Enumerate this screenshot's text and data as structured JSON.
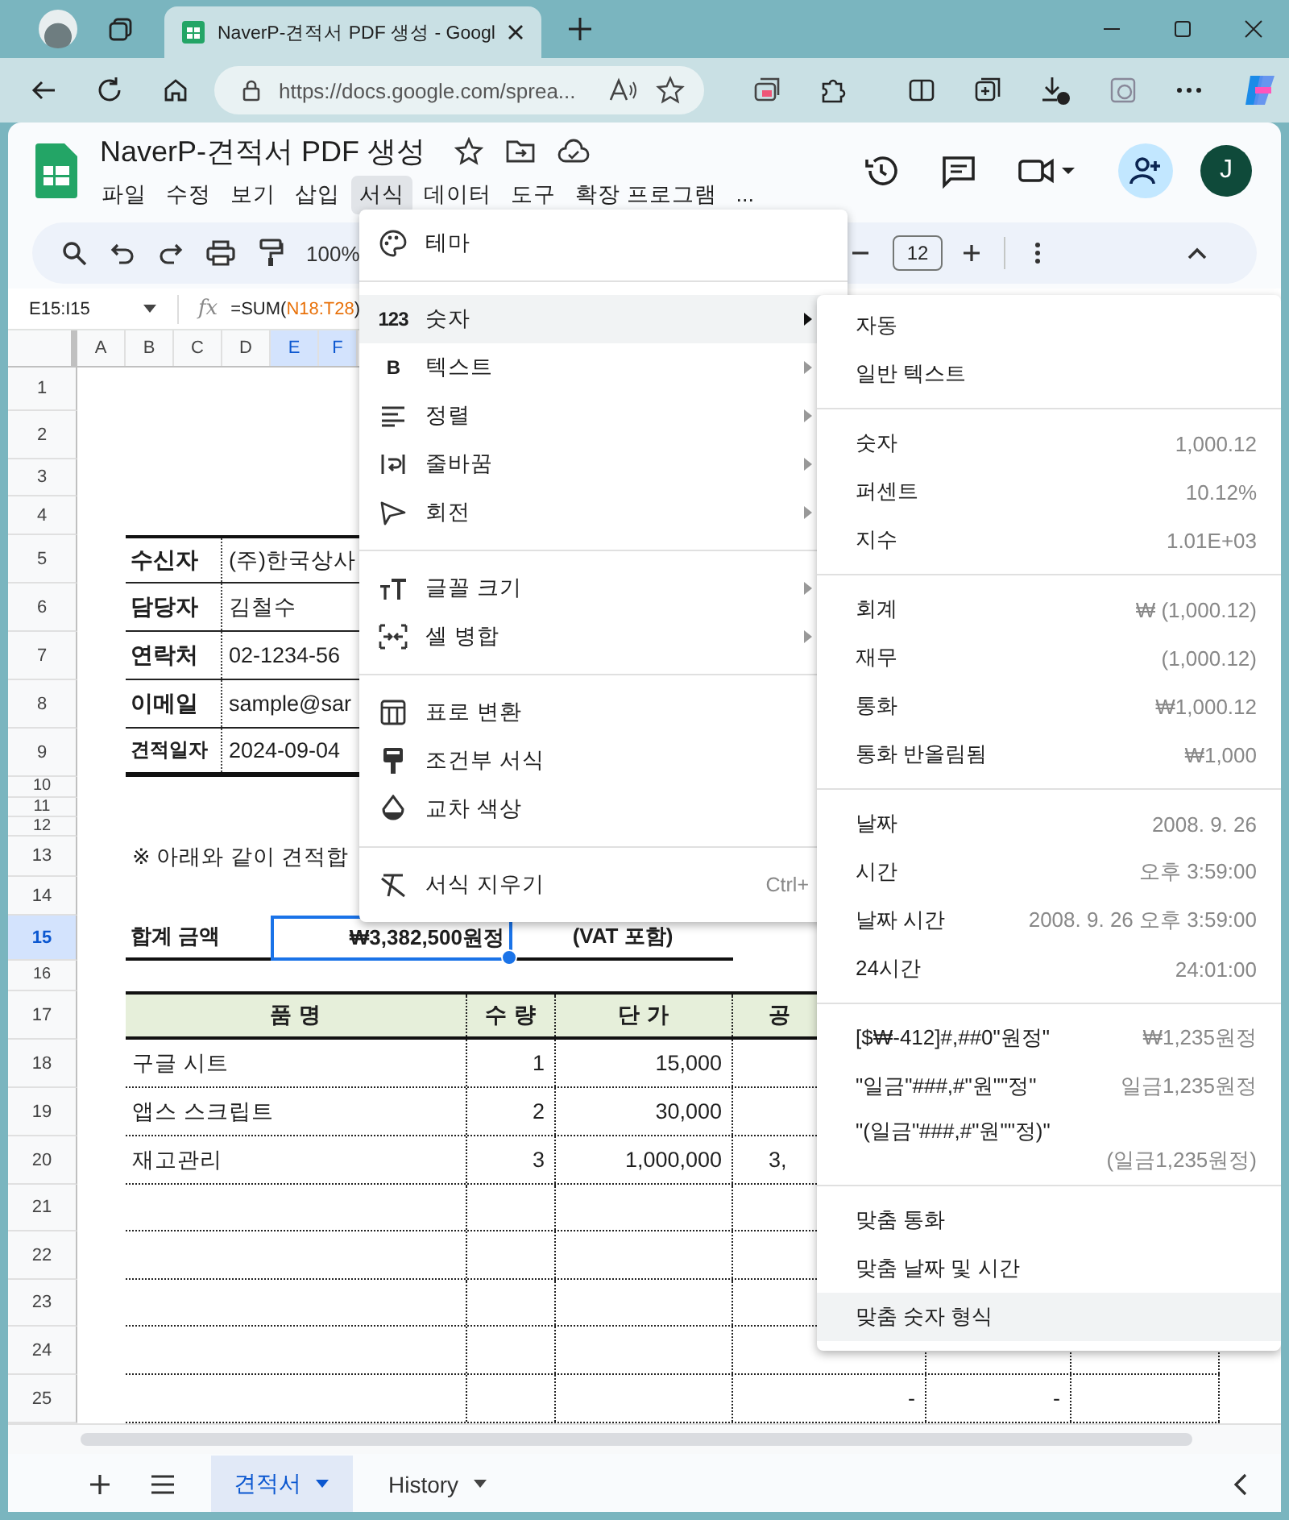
{
  "browser": {
    "tab_title": "NaverP-견적서 PDF 생성 - Googl",
    "url": "https://docs.google.com/sprea..."
  },
  "document": {
    "title": "NaverP-견적서 PDF 생성",
    "avatar_initial": "J"
  },
  "menu_bar": [
    {
      "label": "파일",
      "selected": false
    },
    {
      "label": "수정",
      "selected": false
    },
    {
      "label": "보기",
      "selected": false
    },
    {
      "label": "삽입",
      "selected": false
    },
    {
      "label": "서식",
      "selected": true
    },
    {
      "label": "데이터",
      "selected": false
    },
    {
      "label": "도구",
      "selected": false
    },
    {
      "label": "확장 프로그램",
      "selected": false
    },
    {
      "label": "...",
      "selected": false
    }
  ],
  "toolbar": {
    "zoom": "100%",
    "font_size": "12"
  },
  "formula_bar": {
    "range": "E15:I15",
    "fx": "fx",
    "formula_start": "=SUM(",
    "formula_ref": "N18:T28",
    "formula_end": ")"
  },
  "columns": [
    {
      "label": "A",
      "selected": false
    },
    {
      "label": "B",
      "selected": false
    },
    {
      "label": "C",
      "selected": false
    },
    {
      "label": "D",
      "selected": false
    },
    {
      "label": "E",
      "selected": true
    },
    {
      "label": "F",
      "selected": true
    }
  ],
  "rows": [
    {
      "number": "1",
      "kind": "blank",
      "selected": false
    },
    {
      "number": "2",
      "kind": "blank",
      "selected": false
    },
    {
      "number": "3",
      "kind": "blank",
      "selected": false
    },
    {
      "number": "4",
      "kind": "blank",
      "selected": false
    },
    {
      "number": "5",
      "kind": "info",
      "selected": false,
      "label": "수신자",
      "value": "(주)한국상사"
    },
    {
      "number": "6",
      "kind": "info",
      "selected": false,
      "label": "담당자",
      "value": "김철수"
    },
    {
      "number": "7",
      "kind": "info",
      "selected": false,
      "label": "연락처",
      "value": "02-1234-56"
    },
    {
      "number": "8",
      "kind": "info",
      "selected": false,
      "label": "이메일",
      "value": "sample@sar"
    },
    {
      "number": "9",
      "kind": "info",
      "selected": false,
      "label": "견적일자",
      "value": "2024-09-04"
    },
    {
      "number": "10",
      "kind": "blank",
      "selected": false
    },
    {
      "number": "11",
      "kind": "blank",
      "selected": false
    },
    {
      "number": "12",
      "kind": "blank",
      "selected": false
    },
    {
      "number": "13",
      "kind": "note",
      "selected": false,
      "text": "※ 아래와 같이 견적합"
    },
    {
      "number": "14",
      "kind": "blank",
      "selected": false
    },
    {
      "number": "15",
      "kind": "total",
      "selected": true,
      "label": "합계 금액",
      "value": "₩3,382,500원정",
      "note": "(VAT 포함)"
    },
    {
      "number": "16",
      "kind": "blank",
      "selected": false
    },
    {
      "number": "17",
      "kind": "table_header",
      "selected": false,
      "cells": [
        "품 명",
        "수 량",
        "단 가",
        "공"
      ]
    },
    {
      "number": "18",
      "kind": "table_row",
      "selected": false,
      "cells": [
        "구글 시트",
        "1",
        "15,000"
      ]
    },
    {
      "number": "19",
      "kind": "table_row",
      "selected": false,
      "cells": [
        "앱스 스크립트",
        "2",
        "30,000"
      ]
    },
    {
      "number": "20",
      "kind": "table_row",
      "selected": false,
      "cells": [
        "재고관리",
        "3",
        "1,000,000",
        "3,"
      ]
    },
    {
      "number": "21",
      "kind": "table_row",
      "selected": false
    },
    {
      "number": "22",
      "kind": "table_row",
      "selected": false
    },
    {
      "number": "23",
      "kind": "table_row",
      "selected": false
    },
    {
      "number": "24",
      "kind": "table_row",
      "selected": false
    },
    {
      "number": "25",
      "kind": "table_tail",
      "selected": false,
      "values": [
        "-",
        "-"
      ]
    }
  ],
  "format_menu": [
    [
      {
        "label": "테마",
        "submenu": false,
        "selected": false
      }
    ],
    [
      {
        "glyph": "123",
        "label": "숫자",
        "submenu": true,
        "selected": true
      },
      {
        "glyph": "B",
        "label": "텍스트",
        "submenu": true,
        "selected": false
      },
      {
        "label": "정렬",
        "submenu": true,
        "selected": false
      },
      {
        "label": "줄바꿈",
        "submenu": true,
        "selected": false
      },
      {
        "label": "회전",
        "submenu": true,
        "selected": false
      }
    ],
    [
      {
        "label": "글꼴 크기",
        "submenu": true,
        "selected": false
      },
      {
        "label": "셀 병합",
        "submenu": true,
        "selected": false
      }
    ],
    [
      {
        "label": "표로 변환",
        "submenu": false,
        "selected": false
      },
      {
        "label": "조건부 서식",
        "submenu": false,
        "selected": false
      },
      {
        "label": "교차 색상",
        "submenu": false,
        "selected": false
      }
    ],
    [
      {
        "label": "서식 지우기",
        "shortcut": "Ctrl+",
        "submenu": false,
        "selected": false
      }
    ]
  ],
  "number_menu": [
    [
      {
        "label": "자동",
        "kind": "inline",
        "selected": false
      },
      {
        "label": "일반 텍스트",
        "kind": "inline",
        "selected": false
      }
    ],
    [
      {
        "label": "숫자",
        "example": "1,000.12",
        "kind": "inline",
        "selected": false
      },
      {
        "label": "퍼센트",
        "example": "10.12%",
        "kind": "inline",
        "selected": false
      },
      {
        "label": "지수",
        "example": "1.01E+03",
        "kind": "inline",
        "selected": false
      }
    ],
    [
      {
        "label": "회계",
        "example": "₩ (1,000.12)",
        "kind": "inline",
        "selected": false
      },
      {
        "label": "재무",
        "example": "(1,000.12)",
        "kind": "inline",
        "selected": false
      },
      {
        "label": "통화",
        "example": "₩1,000.12",
        "kind": "inline",
        "selected": false
      },
      {
        "label": "통화 반올림됨",
        "example": "₩1,000",
        "kind": "inline",
        "selected": false
      }
    ],
    [
      {
        "label": "날짜",
        "example": "2008. 9. 26",
        "kind": "inline",
        "selected": false
      },
      {
        "label": "시간",
        "example": "오후 3:59:00",
        "kind": "inline",
        "selected": false
      },
      {
        "label": "날짜 시간",
        "example": "2008. 9. 26 오후 3:59:00",
        "kind": "inline",
        "selected": false
      },
      {
        "label": "24시간",
        "example": "24:01:00",
        "kind": "inline",
        "selected": false
      }
    ],
    [
      {
        "label": "[$₩-412]#,##0\"원정\"",
        "example": "₩1,235원정",
        "kind": "inline",
        "selected": false
      },
      {
        "label": "\"일금\"###,#\"원\"\"정\"",
        "example": "일금1,235원정",
        "kind": "inline",
        "selected": false
      },
      {
        "label": "\"(일금\"###,#\"원\"\"정)\"",
        "example": "(일금1,235원정)",
        "kind": "two_line",
        "selected": false
      }
    ],
    [
      {
        "label": "맞춤 통화",
        "kind": "inline",
        "selected": false
      },
      {
        "label": "맞춤 날짜 및 시간",
        "kind": "inline",
        "selected": false
      },
      {
        "label": "맞춤 숫자 형식",
        "kind": "inline",
        "selected": true
      }
    ]
  ],
  "sheet_tabs": [
    {
      "label": "견적서",
      "selected": true
    },
    {
      "label": "History",
      "selected": false
    }
  ]
}
